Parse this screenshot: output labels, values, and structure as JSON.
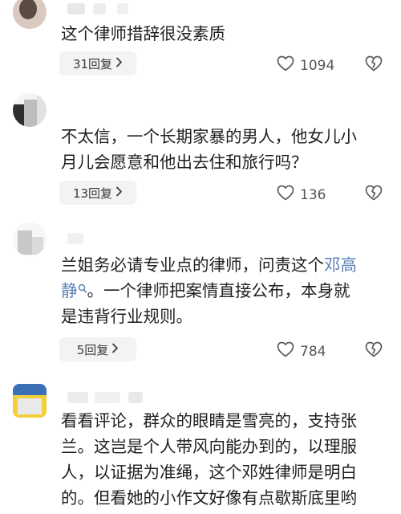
{
  "comments": [
    {
      "text": "这个律师措辞很没素质",
      "reply_label": "31回复",
      "likes": "1094"
    },
    {
      "text_lines": [
        "不太信，一个长期家暴的男人，他女儿小",
        "月儿会愿意和他出去住和旅行吗？"
      ],
      "reply_label": "13回复",
      "likes": "136"
    },
    {
      "line1_before": "兰姐务必请专业点的律师，问责这个",
      "mention_part1": "邓高",
      "mention_part2": "静",
      "line2_after": "。一个律师把案情直接公布，本身就",
      "line3": "是违背行业规则。",
      "reply_label": "5回复",
      "likes": "784"
    },
    {
      "text_lines": [
        "看看评论，群众的眼睛是雪亮的，支持张",
        "兰。这岂是个人带风向能办到的，以理服",
        "人，以证据为准绳，这个邓姓律师是明白",
        "的。但看她的小作文好像有点歇斯底里哟"
      ]
    }
  ],
  "icons": {
    "reply_chevron": "chevron-right-icon",
    "like": "heart-outline-icon",
    "dislike": "broken-heart-icon",
    "mention": "search-icon"
  },
  "colors": {
    "mention": "#5a7fb8",
    "reply_bg": "#f3f3f3"
  }
}
